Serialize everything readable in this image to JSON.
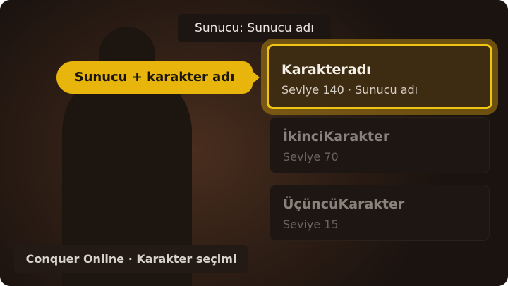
{
  "server_label": "Sunucu: Sunucu adı",
  "callout": "Sunucu + karakter adı",
  "characters": [
    {
      "name": "Karakteradı",
      "subtitle": "Seviye 140 · Sunucu adı",
      "selected": true
    },
    {
      "name": "İkinciKarakter",
      "subtitle": "Seviye 70",
      "selected": false
    },
    {
      "name": "ÜçüncüKarakter",
      "subtitle": "Seviye 15",
      "selected": false
    }
  ],
  "footer": "Conquer Online · Karakter seçimi",
  "colors": {
    "accent": "#e7b50c",
    "selected_border": "#f0c414",
    "background": "#2e1e15"
  }
}
